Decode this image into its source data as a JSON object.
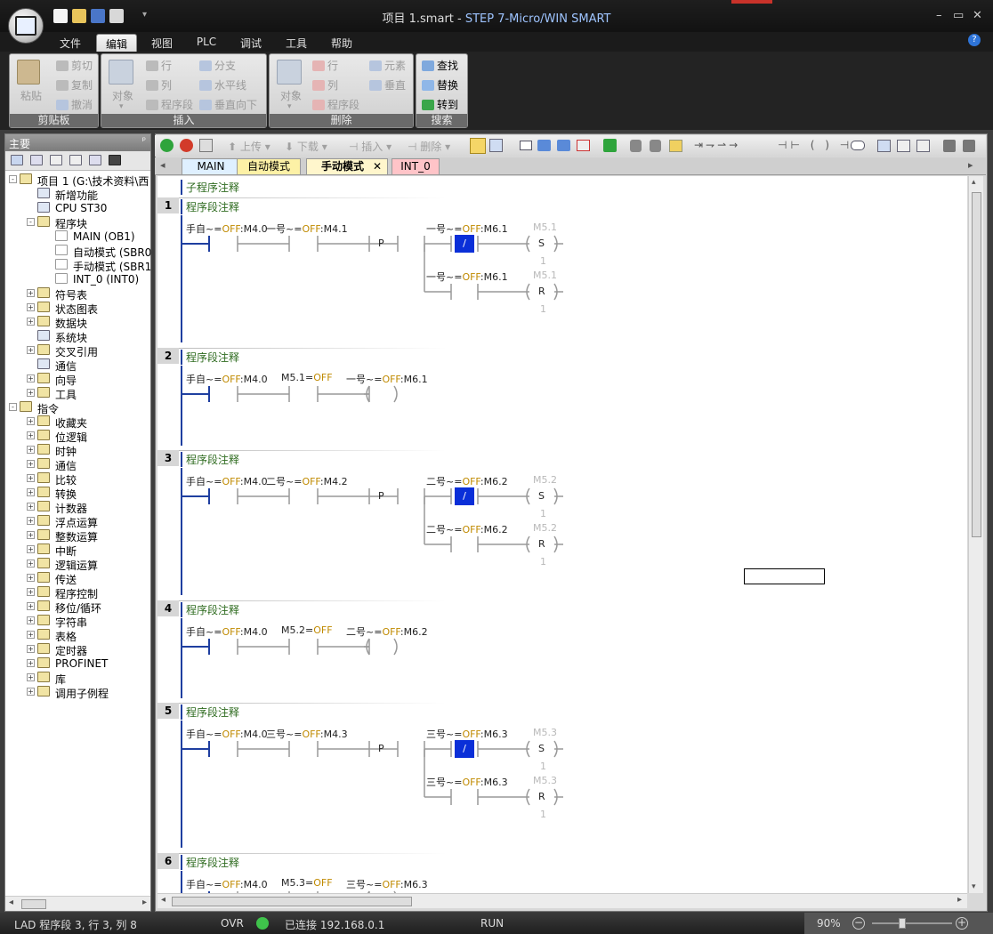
{
  "window": {
    "title_prefix": "项目 1.smart - ",
    "title_app": "STEP 7-Micro/WIN SMART"
  },
  "menu_tabs": [
    "文件",
    "编辑",
    "视图",
    "PLC",
    "调试",
    "工具",
    "帮助"
  ],
  "ribbon": {
    "clipboard": {
      "label": "剪贴板",
      "paste": "粘贴",
      "cut": "剪切",
      "copy": "复制",
      "undo": "撤消"
    },
    "insert": {
      "label": "插入",
      "object": "对象",
      "row": "行",
      "column": "列",
      "segment": "程序段",
      "branch": "分支",
      "horizontal": "水平线",
      "vertical_down": "垂直向下"
    },
    "delete": {
      "label": "删除",
      "object": "对象",
      "row": "行",
      "column": "列",
      "segment": "程序段",
      "element": "元素",
      "vertical": "垂直"
    },
    "search": {
      "label": "搜索",
      "find": "查找",
      "replace": "替换",
      "goto": "转到"
    }
  },
  "left_panel": {
    "title": "主要",
    "tree": [
      {
        "text": "项目 1 (G:\\技术资料\\西",
        "depth": 0,
        "exp": "-"
      },
      {
        "text": "新增功能",
        "depth": 1,
        "exp": ""
      },
      {
        "text": "CPU ST30",
        "depth": 1,
        "exp": ""
      },
      {
        "text": "程序块",
        "depth": 1,
        "exp": "-"
      },
      {
        "text": "MAIN (OB1)",
        "depth": 2,
        "exp": ""
      },
      {
        "text": "自动模式 (SBR0",
        "depth": 2,
        "exp": ""
      },
      {
        "text": "手动模式 (SBR1",
        "depth": 2,
        "exp": ""
      },
      {
        "text": "INT_0 (INT0)",
        "depth": 2,
        "exp": ""
      },
      {
        "text": "符号表",
        "depth": 1,
        "exp": "+"
      },
      {
        "text": "状态图表",
        "depth": 1,
        "exp": "+"
      },
      {
        "text": "数据块",
        "depth": 1,
        "exp": "+"
      },
      {
        "text": "系统块",
        "depth": 1,
        "exp": ""
      },
      {
        "text": "交叉引用",
        "depth": 1,
        "exp": "+"
      },
      {
        "text": "通信",
        "depth": 1,
        "exp": ""
      },
      {
        "text": "向导",
        "depth": 1,
        "exp": "+"
      },
      {
        "text": "工具",
        "depth": 1,
        "exp": "+"
      },
      {
        "text": "指令",
        "depth": 0,
        "exp": "-"
      },
      {
        "text": "收藏夹",
        "depth": 1,
        "exp": "+"
      },
      {
        "text": "位逻辑",
        "depth": 1,
        "exp": "+"
      },
      {
        "text": "时钟",
        "depth": 1,
        "exp": "+"
      },
      {
        "text": "通信",
        "depth": 1,
        "exp": "+"
      },
      {
        "text": "比较",
        "depth": 1,
        "exp": "+"
      },
      {
        "text": "转换",
        "depth": 1,
        "exp": "+"
      },
      {
        "text": "计数器",
        "depth": 1,
        "exp": "+"
      },
      {
        "text": "浮点运算",
        "depth": 1,
        "exp": "+"
      },
      {
        "text": "整数运算",
        "depth": 1,
        "exp": "+"
      },
      {
        "text": "中断",
        "depth": 1,
        "exp": "+"
      },
      {
        "text": "逻辑运算",
        "depth": 1,
        "exp": "+"
      },
      {
        "text": "传送",
        "depth": 1,
        "exp": "+"
      },
      {
        "text": "程序控制",
        "depth": 1,
        "exp": "+"
      },
      {
        "text": "移位/循环",
        "depth": 1,
        "exp": "+"
      },
      {
        "text": "字符串",
        "depth": 1,
        "exp": "+"
      },
      {
        "text": "表格",
        "depth": 1,
        "exp": "+"
      },
      {
        "text": "定时器",
        "depth": 1,
        "exp": "+"
      },
      {
        "text": "PROFINET",
        "depth": 1,
        "exp": "+"
      },
      {
        "text": "库",
        "depth": 1,
        "exp": "+"
      },
      {
        "text": "调用子例程",
        "depth": 1,
        "exp": "+"
      }
    ]
  },
  "toolbar": {
    "upload": "上传",
    "download": "下载",
    "insert": "插入",
    "delete": "删除"
  },
  "program_tabs": [
    "MAIN",
    "自动模式",
    "手动模式",
    "INT_0"
  ],
  "editor": {
    "sub_comment": "子程序注释",
    "seg_comment": "程序段注释",
    "networks": [
      {
        "n": "1",
        "type": "set",
        "a": "手自~",
        "a2": ":M4.0",
        "b": "一号~",
        "b2": ":M4.1",
        "c": "一号~",
        "c2": ":M6.1",
        "d": "一号~",
        "d2": ":M6.1",
        "coil": "M5.1"
      },
      {
        "n": "2",
        "type": "out",
        "a": "手自~",
        "a2": ":M4.0",
        "b": "M5.1=",
        "c": "一号~",
        "c2": ":M6.1"
      },
      {
        "n": "3",
        "type": "set",
        "a": "手自~",
        "a2": ":M4.0",
        "b": "二号~",
        "b2": ":M4.2",
        "c": "二号~",
        "c2": ":M6.2",
        "d": "二号~",
        "d2": ":M6.2",
        "coil": "M5.2"
      },
      {
        "n": "4",
        "type": "out",
        "a": "手自~",
        "a2": ":M4.0",
        "b": "M5.2=",
        "c": "二号~",
        "c2": ":M6.2"
      },
      {
        "n": "5",
        "type": "set",
        "a": "手自~",
        "a2": ":M4.0",
        "b": "三号~",
        "b2": ":M4.3",
        "c": "三号~",
        "c2": ":M6.3",
        "d": "三号~",
        "d2": ":M6.3",
        "coil": "M5.3"
      },
      {
        "n": "6",
        "type": "out",
        "a": "手自~",
        "a2": ":M4.0",
        "b": "M5.3=",
        "c": "三号~",
        "c2": ":M6.3"
      }
    ],
    "eq": "=",
    "off": "OFF",
    "p": "P",
    "neg": "/",
    "s": "S",
    "r": "R",
    "one": "1"
  },
  "status": {
    "mode": "LAD 程序段 3, 行 3, 列 8",
    "ovr": "OVR",
    "connected": "已连接 192.168.0.1",
    "run": "RUN",
    "zoom": "90%"
  },
  "colors": {
    "accent": "#1f3fa0",
    "value": "#c08a00",
    "comment": "#2e6b1f",
    "selected": "#0a2fd8"
  }
}
